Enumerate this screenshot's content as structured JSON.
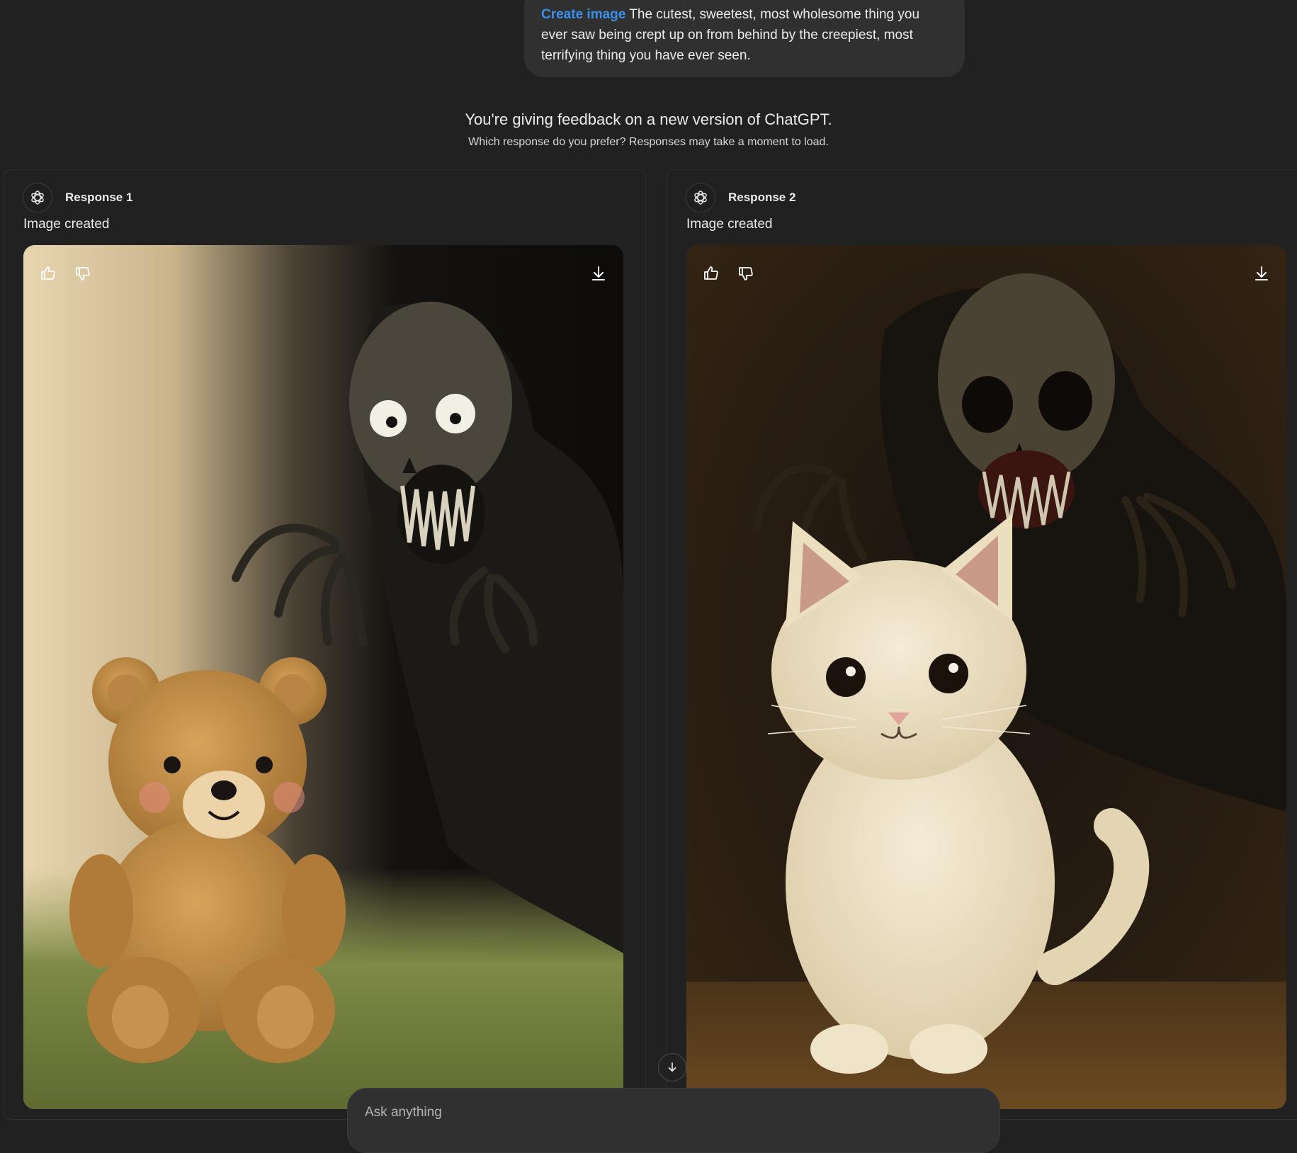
{
  "prompt": {
    "tag": "Create image",
    "text": "The cutest, sweetest, most wholesome thing you ever saw being crept up on from behind by the creepiest, most terrifying thing you have ever seen."
  },
  "feedback": {
    "title": "You're giving feedback on a new version of ChatGPT.",
    "subtitle": "Which response do you prefer? Responses may take a moment to load."
  },
  "responses": [
    {
      "label": "Response 1",
      "status": "Image created"
    },
    {
      "label": "Response 2",
      "status": "Image created"
    }
  ],
  "composer": {
    "placeholder": "Ask anything"
  },
  "colors": {
    "accent": "#3b8fea",
    "background": "#212121",
    "bubble": "#303030"
  }
}
